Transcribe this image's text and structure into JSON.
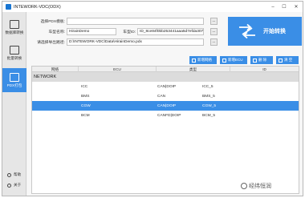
{
  "window": {
    "title": "INTEWORK-VDC(ODX)"
  },
  "sidebar": {
    "items": [
      {
        "label": "数据库转换",
        "icon": "database-convert-icon"
      },
      {
        "label": "批量转换",
        "icon": "batch-convert-icon"
      },
      {
        "label": "PDX打包",
        "icon": "pdx-package-icon",
        "active": true
      }
    ],
    "bottom": [
      {
        "label": "帮助",
        "icon": "help-icon"
      },
      {
        "label": "关于",
        "icon": "about-icon"
      }
    ]
  },
  "form": {
    "pdx_template_label": "选择PDX模板:",
    "pdx_template_value": "",
    "vehicle_name_label": "车型名称:",
    "vehicle_name_value": "HirainDemo",
    "vehicle_id_label": "车型ID:",
    "vehicle_id_value": "ID_8ce84f0bb253441aaa5d7efda307cc8",
    "save_path_label": "请选择导出路径:",
    "save_path_value": "D:\\INTEWORK-VDC\\Data\\HirainDemo.pdx",
    "browse_label": "..."
  },
  "start_button": {
    "label": "开始转换"
  },
  "toolbar": {
    "add_network": "新增网络",
    "add_ecu": "新增ECU",
    "delete": "删 除",
    "clear": "清 空"
  },
  "table": {
    "columns": [
      "网络",
      "ECU",
      "类型",
      "ID"
    ],
    "group": "NETWORK",
    "rows": [
      {
        "ecu": "ICC",
        "type": "CAN|DOIP",
        "id": "ICC_5",
        "selected": false
      },
      {
        "ecu": "BMS",
        "type": "CAN",
        "id": "BMS_5",
        "selected": false
      },
      {
        "ecu": "CGW",
        "type": "CAN|DOIP",
        "id": "CGW_5",
        "selected": true
      },
      {
        "ecu": "BCM",
        "type": "CANFD|DOIP",
        "id": "BCM_5",
        "selected": false
      }
    ]
  },
  "watermark": {
    "text": "经纬恒润"
  },
  "colors": {
    "accent": "#3a8ee6",
    "sidebar_bg": "#e6e6e6",
    "header_bg": "#eeeeee"
  }
}
